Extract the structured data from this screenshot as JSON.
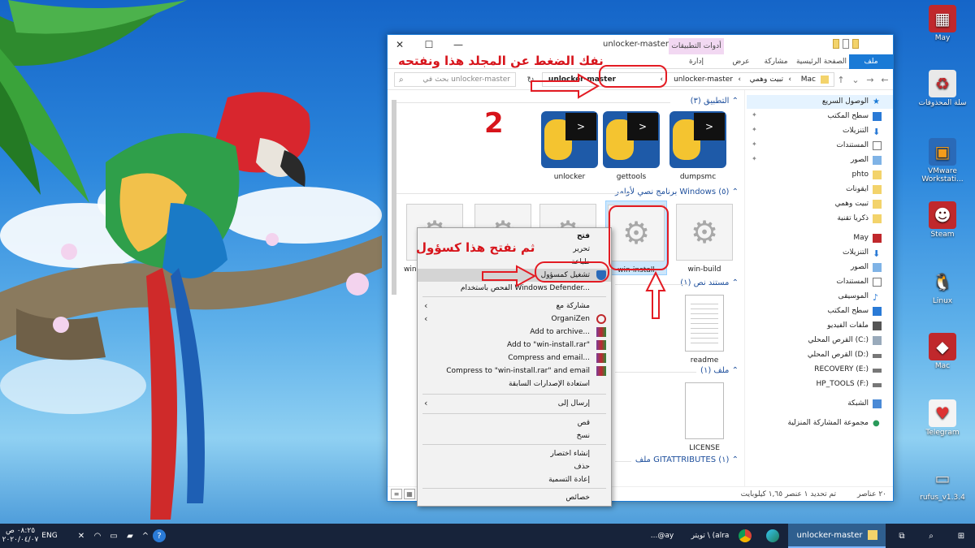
{
  "window": {
    "title": "unlocker-master",
    "app_tools_label": "أدوات التطبيقات",
    "ribbon_tabs": [
      {
        "label": "ملف",
        "active": true
      },
      {
        "label": "الصفحة الرئيسية"
      },
      {
        "label": "مشاركة"
      },
      {
        "label": "عرض"
      },
      {
        "label": "إدارة"
      }
    ],
    "address": {
      "seg1": "Mac",
      "seg2": "تبيت وهمي",
      "seg3": "unlocker-master",
      "seg4": "unlocker-master"
    },
    "search_placeholder": "بحث في unlocker-master"
  },
  "groups": {
    "app": "التطبيق (٣)",
    "script": "برنامج نصي لأوامر Windows (٥)",
    "text": "مستند نص (١)",
    "file": "ملف (١)",
    "gitattr": "ملف GITATTRIBUTES (١)"
  },
  "files": {
    "dumpsmc": "dumpsmc",
    "gettools": "gettools",
    "unlocker": "unlocker",
    "win_build": "win-build",
    "win_install": "win-install",
    "hidden1": "win",
    "readme": "readme",
    "license": "LICENSE"
  },
  "nav": {
    "quick_access": "الوصول السريع",
    "desktop": "سطح المكتب",
    "downloads": "التنزيلات",
    "documents": "المستندات",
    "pictures": "الصور",
    "phto": "phto",
    "icons": "ايقونات",
    "tbit": "تبيت وهمي",
    "tech": "ذكريا تقنية",
    "may": "May",
    "downloads2": "التنزيلات",
    "pictures2": "الصور",
    "documents2": "المستندات",
    "music": "الموسيقى",
    "desktop2": "سطح المكتب",
    "videos": "ملفات الفيديو",
    "drive_c": "القرص المحلي (C:)",
    "drive_d": "القرص المحلي (D:)",
    "drive_e": "RECOVERY (E:)",
    "drive_f": "HP_TOOLS (F:)",
    "network": "الشبكة",
    "homegroup": "مجموعة المشاركة المنزلية"
  },
  "status": {
    "count": "٢٠ عناصر",
    "selected": "تم تحديد ١ عنصر  ١,٦٥ كيلوبايت"
  },
  "context_menu": {
    "open": "فتح",
    "edit": "تحرير",
    "print": "طباعة",
    "run_admin": "تشغيل كمسؤول",
    "defender": "الفحص باستخدام Windows Defender...",
    "share_with": "مشاركة مع",
    "organizen": "OrganiZen",
    "add_archive": "Add to archive...",
    "add_rar": "Add to \"win-install.rar\"",
    "compress_email": "Compress and email...",
    "compress_rar_email": "Compress to \"win-install.rar\" and email",
    "restore": "استعادة الإصدارات السابقة",
    "send_to": "إرسال إلى",
    "cut": "قص",
    "copy": "نسخ",
    "shortcut": "إنشاء اختصار",
    "delete": "حذف",
    "rename": "إعادة التسمية",
    "properties": "خصائص"
  },
  "annotations": {
    "top": "نفك الضغط عن المجلد هذا ونفتحه",
    "number": "2",
    "admin": "ثم نفتح هذا كسؤول"
  },
  "desktop_icons": {
    "may": "May",
    "recycle": "سلة المحذوفات",
    "vmware": "VMware Workstati...",
    "steam": "Steam",
    "linux": "Linux",
    "mac": "Mac",
    "telegram": "Telegram",
    "rufus": "rufus_v1.3.4"
  },
  "taskbar": {
    "explorer_label": "unlocker-master",
    "twitter_label": "تويتر \\ (alra",
    "ebay_label": "...@ay",
    "time": "٠٨:٢٥ ص",
    "date": "٢٠٢٠/٠٤/٠٧",
    "lang": "ENG"
  },
  "colors": {
    "accent": "#1a7ad6",
    "annotation": "#d7141b",
    "taskbar": "#17233a"
  }
}
